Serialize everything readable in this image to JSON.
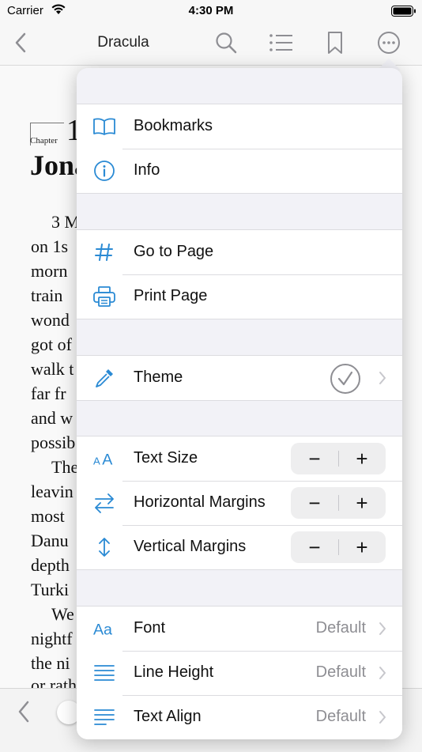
{
  "status_bar": {
    "carrier": "Carrier",
    "time": "4:30 PM"
  },
  "nav": {
    "title": "Dracula"
  },
  "reader": {
    "chapter_label": "Chapter",
    "chapter_number": "1",
    "chapter_title": "Jona",
    "lines": [
      "3 M",
      "on 1s",
      "morn",
      "train",
      "wond",
      "got of",
      "walk t",
      "far fr",
      "and w",
      "possib",
      "The",
      "leavin",
      "most",
      "Danu",
      "depth",
      "Turki",
      "We",
      "nightf",
      "the ni",
      "or rath"
    ]
  },
  "menu": {
    "bookmarks": "Bookmarks",
    "info": "Info",
    "go_to_page": "Go to Page",
    "print_page": "Print Page",
    "theme": "Theme",
    "text_size": "Text Size",
    "horizontal_margins": "Horizontal Margins",
    "vertical_margins": "Vertical Margins",
    "minus": "−",
    "plus": "+",
    "font": "Font",
    "font_value": "Default",
    "line_height": "Line Height",
    "line_height_value": "Default",
    "text_align": "Text Align",
    "text_align_value": "Default"
  },
  "colors": {
    "accent": "#2a8ad4",
    "nav_icon": "#8e8e93",
    "secondary_text": "#8e8e93"
  }
}
